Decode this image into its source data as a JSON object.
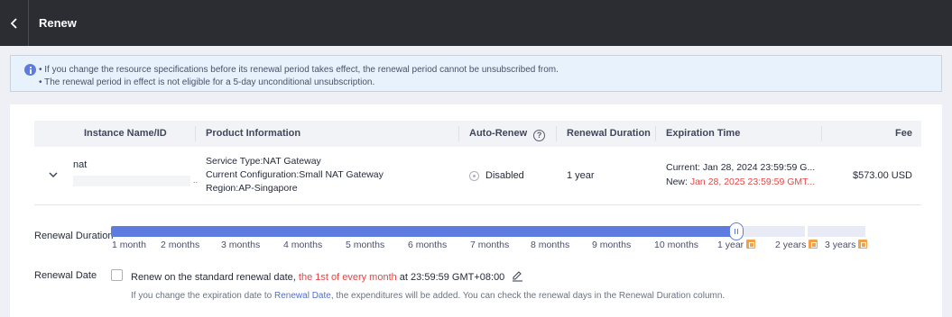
{
  "header": {
    "title": "Renew",
    "back_icon": "chevron-left-icon"
  },
  "notice": {
    "icon": "info-icon",
    "lines": [
      "•  If you change the resource specifications before its renewal period takes effect, the renewal period cannot be unsubscribed from.",
      "•  The renewal period in effect is not eligible for a 5-day unconditional unsubscription."
    ]
  },
  "table": {
    "headers": {
      "instance": "Instance Name/ID",
      "product": "Product Information",
      "auto_renew": "Auto-Renew",
      "duration": "Renewal Duration",
      "expiration": "Expiration Time",
      "fee": "Fee"
    },
    "help_icon": "?",
    "row": {
      "name": "nat",
      "id_suffix": "..",
      "service_type": "Service Type:NAT Gateway",
      "configuration": "Current Configuration:Small NAT Gateway",
      "region": "Region:AP-Singapore",
      "auto_renew": "Disabled",
      "duration": "1 year",
      "current_expiration": "Current: Jan 28, 2024 23:59:59 G...",
      "new_expiration_label": "New: ",
      "new_expiration_value": "Jan 28, 2025 23:59:59 GMT...",
      "fee": "$573.00 USD"
    }
  },
  "renewal_duration": {
    "label": "Renewal Duration",
    "options": [
      "1 month",
      "2 months",
      "3 months",
      "4 months",
      "5 months",
      "6 months",
      "7 months",
      "8 months",
      "9 months",
      "10 months",
      "1 year",
      "2 years",
      "3 years"
    ],
    "selected": "1 year",
    "selected_index": 10,
    "discount_icon": "discount-icon"
  },
  "renewal_date": {
    "label": "Renewal Date",
    "checked": false,
    "text_prefix": "Renew on the standard renewal date, ",
    "text_highlight": "the 1st of every month",
    "text_suffix": " at 23:59:59 GMT+08:00",
    "hint_prefix": "If you change the expiration date to ",
    "hint_link": "Renewal Date",
    "hint_suffix": ", the expenditures will be added. You can check the renewal days in the Renewal Duration column."
  },
  "colors": {
    "accent": "#5e7ce0",
    "warning_text": "#e54545",
    "discount": "#f2a04a",
    "topbar": "#2c2d33"
  }
}
